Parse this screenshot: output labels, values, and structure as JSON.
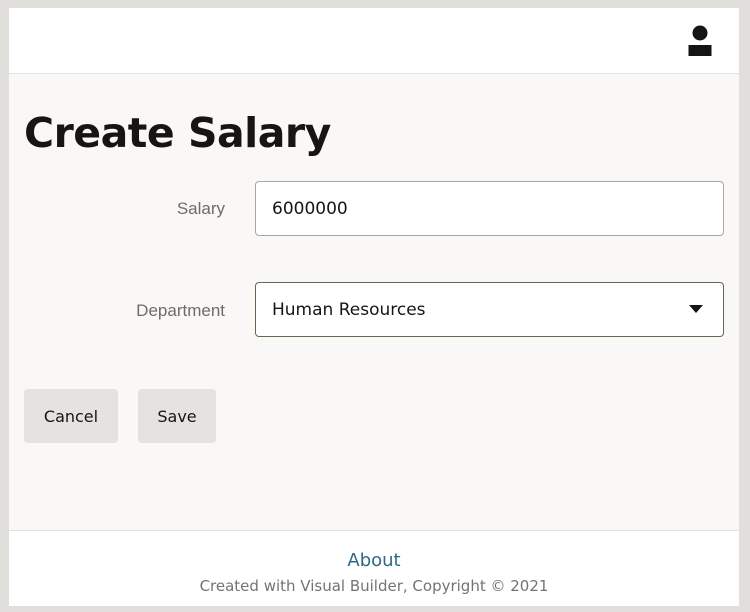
{
  "header": {
    "user_icon": "user-avatar-icon"
  },
  "page": {
    "title": "Create Salary"
  },
  "form": {
    "salary": {
      "label": "Salary",
      "value": "6000000"
    },
    "department": {
      "label": "Department",
      "value": "Human Resources",
      "icon": "caret-down-icon"
    }
  },
  "actions": {
    "cancel_label": "Cancel",
    "save_label": "Save"
  },
  "footer": {
    "about_label": "About",
    "copyright": "Created with Visual Builder, Copyright © 2021"
  },
  "colors": {
    "background": "#f9f8f6",
    "surface": "#ffffff",
    "text": "#161513",
    "link": "#2b6a8a",
    "button_bg": "#e5e3df",
    "select_border": "#5d6a4e"
  }
}
